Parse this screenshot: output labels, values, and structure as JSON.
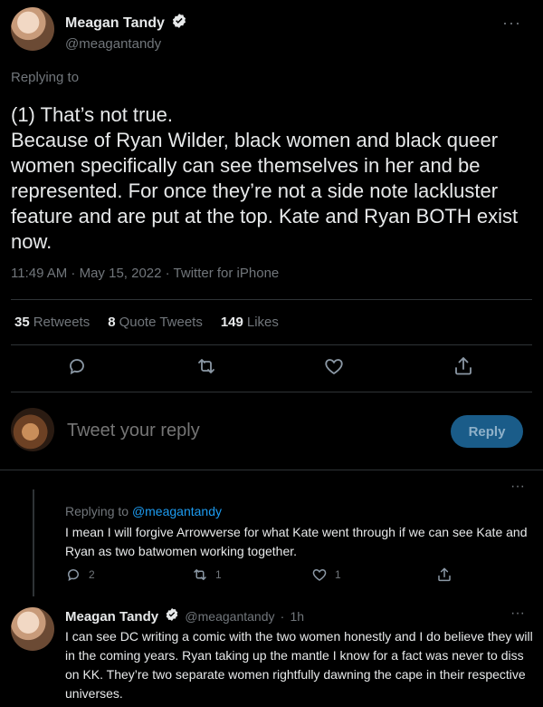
{
  "main_tweet": {
    "author_name": "Meagan Tandy",
    "author_handle": "@meagantandy",
    "replying_label": "Replying to",
    "text": "(1) That’s not true.\nBecause of Ryan Wilder, black women and black queer women specifically can see themselves in her and be represented. For once they’re not a side note lackluster feature and are put at the top. Kate and Ryan BOTH exist now.",
    "meta": "11:49 AM · May 15, 2022 · Twitter for iPhone",
    "stats": {
      "retweets_count": "35",
      "retweets_label": "Retweets",
      "quotes_count": "8",
      "quotes_label": "Quote Tweets",
      "likes_count": "149",
      "likes_label": "Likes"
    }
  },
  "compose": {
    "placeholder": "Tweet your reply",
    "button_label": "Reply"
  },
  "reply_tweet": {
    "replying_prefix": "Replying to",
    "replying_handle": "@meagantandy",
    "text": "I mean I will forgive Arrowverse for what Kate went through if we can see Kate and Ryan as two batwomen working together.",
    "reply_count": "2",
    "retweet_count": "1",
    "like_count": "1"
  },
  "second_tweet": {
    "author_name": "Meagan Tandy",
    "author_handle": "@meagantandy",
    "time": "1h",
    "text": "I can see DC writing a comic with the two women honestly and I do believe they will in the coming years. Ryan taking up the mantle I know for a fact was never to diss on KK. They’re two separate women rightfully dawning the cape in their respective universes."
  },
  "colors": {
    "background": "#000000",
    "text": "#e7e9ea",
    "muted": "#71767b",
    "accent": "#1d9bf0",
    "reply_button": "#1a5c89"
  }
}
